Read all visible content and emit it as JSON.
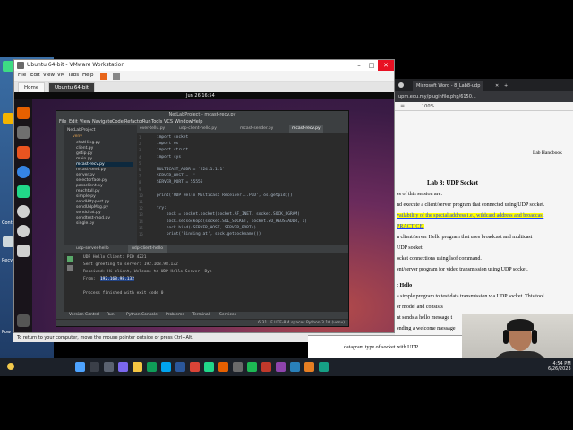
{
  "vmware": {
    "title": "Ubuntu 64-bit - VMware Workstation",
    "menus": [
      "File",
      "Edit",
      "View",
      "VM",
      "Tabs",
      "Help"
    ],
    "tabs": [
      "Home",
      "Ubuntu 64-bit"
    ],
    "hint": "To return to your computer, move the mouse pointer outside or press Ctrl+Alt."
  },
  "ubuntu": {
    "clock": "Jun 26  16:54"
  },
  "pycharm": {
    "title": "NetLabProject - mcast-recv.py",
    "menus": [
      "File",
      "Edit",
      "View",
      "Navigate",
      "Code",
      "Refactor",
      "Run",
      "Tools",
      "VCS",
      "Window",
      "Help"
    ],
    "project_root": "NetLabProject",
    "project_root_path": "~/PycharmProjects/NetLabProject",
    "tree": [
      "venv",
      "chatHing.py",
      "client.py",
      "getip.py",
      "main.py",
      "mcast-recv.py",
      "mcast-send.py",
      "server.py",
      "selectorface.py",
      "passclient.py",
      "reachtall.py",
      "simple.py",
      "sendHttppost.py",
      "sendUdpMsg.py",
      "sendchat.py",
      "sendtest-mod.py",
      "single.py"
    ],
    "selected_file": "mcast-recv.py",
    "editor_tabs": [
      "ever-tellu.py",
      "udp-client-hello.py",
      "mcast-sender.py",
      "mcast-recv.py"
    ],
    "active_tab": "mcast-recv.py",
    "code_lines": [
      {
        "n": "1",
        "text": "import socket"
      },
      {
        "n": "2",
        "text": "import os"
      },
      {
        "n": "3",
        "text": "import struct"
      },
      {
        "n": "4",
        "text": "import sys"
      },
      {
        "n": "5",
        "text": ""
      },
      {
        "n": "6",
        "text": "MULTICAST_ADDR = '224.1.1.1'"
      },
      {
        "n": "7",
        "text": "SERVER_HOST = ''"
      },
      {
        "n": "8",
        "text": "SERVER_PORT = 55555"
      },
      {
        "n": "9",
        "text": ""
      },
      {
        "n": "10",
        "text": "print('UDP Hello Multicast Receiver...PID', os.getpid())"
      },
      {
        "n": "11",
        "text": ""
      },
      {
        "n": "12",
        "text": "try:"
      },
      {
        "n": "13",
        "text": "    sock = socket.socket(socket.AF_INET, socket.SOCK_DGRAM)"
      },
      {
        "n": "14",
        "text": "    sock.setsockopt(socket.SOL_SOCKET, socket.SO_REUSEADDR, 1)"
      },
      {
        "n": "15",
        "text": "    sock.bind((SERVER_HOST, SERVER_PORT))"
      },
      {
        "n": "16",
        "text": "    print('Binding at', sock.getsockname())"
      }
    ],
    "run_tabs": [
      "udp-server-hello",
      "udp-client-hello"
    ],
    "run_output": [
      "UDP Hello Client: PID 4221",
      "Sent greeting to server: 192.168.98.132",
      "Received: Hi client, Welcome to UDP Hello Server. Bye",
      "From:  192.168.98.132",
      "",
      "Process finished with exit code 0"
    ],
    "highlight_ip": "192.168.98.132",
    "bottom_tabs": [
      "Version Control",
      "Run",
      "Python Console",
      "Problems",
      "Terminal",
      "Services"
    ],
    "status": "6:31  LF  UTF-8  4 spaces  Python 3.10 (venv)"
  },
  "browser": {
    "tab1": "Microsoft Word - 8_Lab8-udp",
    "url": "upm.edu.my/pluginfile.php/6150...",
    "zoom": "100%",
    "doc_header": "Lab Handbook",
    "doc_title": "Lab 8: UDP Socket",
    "doc_lines": [
      "es of this session are:",
      "nd execute a client/server program that connected using UDP socket.",
      "vailability of the special address i.e., wildcard address and broadcast",
      "PRACTICE.",
      "n client/server Hello program that uses broadcast and multicast",
      "UDP socket.",
      "ocket connections using lsof command.",
      "ent/server program for video transmission using UDP socket.",
      ": Hello",
      "a simple program to test data transmission via UDP socket.  This tool",
      "er  model  and  consists",
      "nt sends a hello message t",
      "ending a welcome message"
    ],
    "overlap_line": "datagram type of socket with UDP."
  },
  "desktop": {
    "labels": [
      "Cont",
      "Recy",
      "Pow"
    ]
  },
  "taskbar": {
    "time": "4:54 PM",
    "date": "6/26/2023"
  }
}
